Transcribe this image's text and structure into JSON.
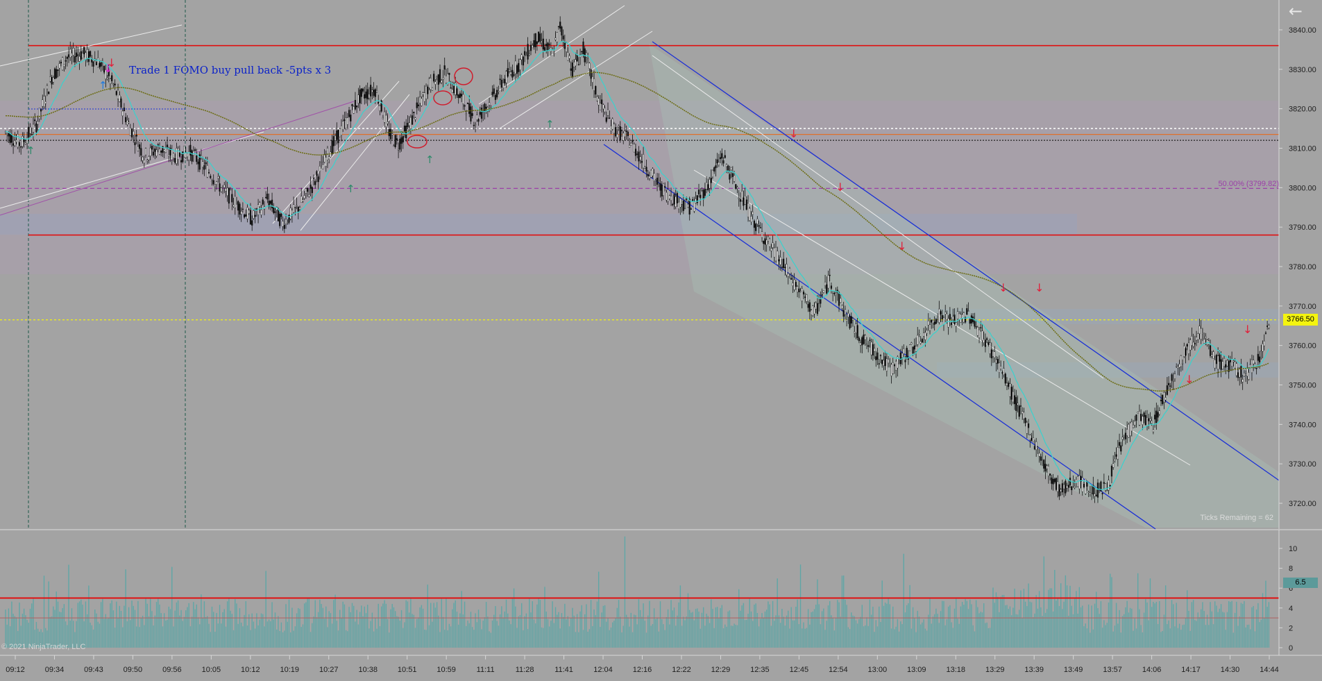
{
  "instrument_annotation": "Trade 1 FOMO buy pull back -5pts x 3",
  "fib_label": "50.00% (3799.82)",
  "ticks_remaining": "Ticks Remaining = 62",
  "copyright": "© 2021 NinjaTrader, LLC",
  "last_price": "3766.50",
  "last_volume": "6.5",
  "back_icon": "back-arrow-icon",
  "colors": {
    "background": "#a3a3a3",
    "support_resistance": "#e01010",
    "channel_blue": "#1a2fd6",
    "channel_white": "#ececec",
    "moving_average": "#3fd0cc",
    "slow_average": "#6b6b10",
    "volume_bar": "#5fa6a6",
    "buy_arrow": "#2d8a6a",
    "sell_arrow": "#e0203a",
    "last_price_line": "#f4f40f"
  },
  "chart_data": {
    "type": "candlestick",
    "price_axis": {
      "ticks": [
        "3840.00",
        "3830.00",
        "3820.00",
        "3810.00",
        "3800.00",
        "3790.00",
        "3780.00",
        "3770.00",
        "3760.00",
        "3750.00",
        "3740.00",
        "3730.00",
        "3720.00"
      ],
      "range": [
        3715,
        3845
      ]
    },
    "time_axis": {
      "ticks": [
        "09:12",
        "09:34",
        "09:43",
        "09:50",
        "09:56",
        "10:05",
        "10:12",
        "10:19",
        "10:27",
        "10:38",
        "10:51",
        "10:59",
        "11:11",
        "11:28",
        "11:41",
        "12:04",
        "12:16",
        "12:22",
        "12:29",
        "12:35",
        "12:45",
        "12:54",
        "13:00",
        "13:09",
        "13:18",
        "13:29",
        "13:39",
        "13:49",
        "13:57",
        "14:06",
        "14:17",
        "14:30",
        "14:44"
      ]
    },
    "horizontal_levels": [
      {
        "name": "upper resistance",
        "value": 3836
      },
      {
        "name": "lower support",
        "value": 3788
      },
      {
        "name": "white dotted",
        "value": 3815
      },
      {
        "name": "orange",
        "value": 3813.5
      },
      {
        "name": "black dotted",
        "value": 3812
      },
      {
        "name": "fib 50%",
        "value": 3799.82
      },
      {
        "name": "last price",
        "value": 3766.5
      }
    ],
    "price_path": [
      [
        0,
        3814
      ],
      [
        10,
        3811
      ],
      [
        20,
        3816
      ],
      [
        30,
        3828
      ],
      [
        40,
        3833
      ],
      [
        50,
        3834
      ],
      [
        60,
        3832
      ],
      [
        70,
        3826
      ],
      [
        80,
        3816
      ],
      [
        90,
        3808
      ],
      [
        100,
        3810
      ],
      [
        110,
        3808
      ],
      [
        120,
        3809
      ],
      [
        130,
        3805
      ],
      [
        140,
        3800
      ],
      [
        150,
        3796
      ],
      [
        160,
        3792
      ],
      [
        170,
        3797
      ],
      [
        180,
        3791
      ],
      [
        190,
        3795
      ],
      [
        200,
        3801
      ],
      [
        210,
        3809
      ],
      [
        220,
        3816
      ],
      [
        230,
        3823
      ],
      [
        240,
        3825
      ],
      [
        250,
        3813
      ],
      [
        255,
        3811
      ],
      [
        265,
        3818
      ],
      [
        275,
        3826
      ],
      [
        285,
        3829
      ],
      [
        295,
        3823
      ],
      [
        305,
        3817
      ],
      [
        315,
        3822
      ],
      [
        325,
        3828
      ],
      [
        335,
        3832
      ],
      [
        345,
        3838
      ],
      [
        355,
        3834
      ],
      [
        360,
        3841
      ],
      [
        368,
        3830
      ],
      [
        375,
        3835
      ],
      [
        385,
        3822
      ],
      [
        395,
        3815
      ],
      [
        405,
        3812
      ],
      [
        415,
        3806
      ],
      [
        425,
        3800
      ],
      [
        435,
        3797
      ],
      [
        445,
        3795
      ],
      [
        455,
        3800
      ],
      [
        465,
        3808
      ],
      [
        475,
        3800
      ],
      [
        485,
        3792
      ],
      [
        495,
        3786
      ],
      [
        505,
        3780
      ],
      [
        515,
        3774
      ],
      [
        525,
        3768
      ],
      [
        535,
        3777
      ],
      [
        545,
        3768
      ],
      [
        555,
        3762
      ],
      [
        565,
        3758
      ],
      [
        575,
        3754
      ],
      [
        585,
        3758
      ],
      [
        595,
        3762
      ],
      [
        605,
        3768
      ],
      [
        615,
        3766
      ],
      [
        625,
        3768
      ],
      [
        635,
        3762
      ],
      [
        645,
        3755
      ],
      [
        655,
        3746
      ],
      [
        665,
        3738
      ],
      [
        675,
        3729
      ],
      [
        685,
        3723
      ],
      [
        695,
        3726
      ],
      [
        705,
        3723
      ],
      [
        715,
        3724
      ],
      [
        725,
        3736
      ],
      [
        735,
        3742
      ],
      [
        745,
        3740
      ],
      [
        755,
        3750
      ],
      [
        765,
        3758
      ],
      [
        775,
        3764
      ],
      [
        785,
        3756
      ],
      [
        795,
        3755
      ],
      [
        805,
        3752
      ],
      [
        815,
        3758
      ],
      [
        820,
        3766
      ]
    ],
    "volume_axis": {
      "ticks": [
        "10",
        "8",
        "6",
        "4",
        "2",
        "0"
      ],
      "range": [
        0,
        12
      ],
      "threshold": 5
    }
  }
}
